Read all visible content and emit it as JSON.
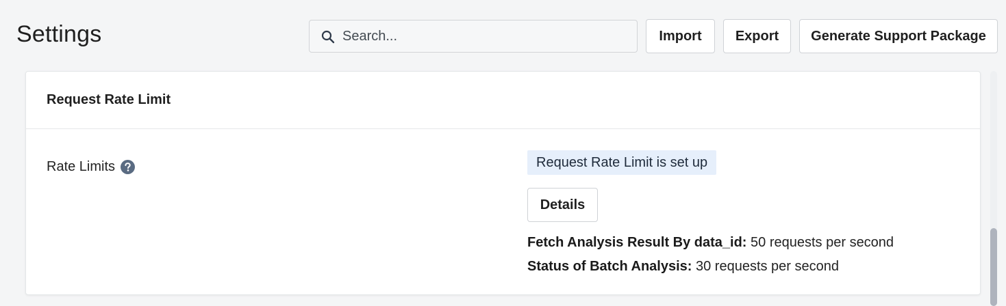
{
  "header": {
    "title": "Settings",
    "search_placeholder": "Search...",
    "import_label": "Import",
    "export_label": "Export",
    "support_label": "Generate Support Package"
  },
  "card": {
    "title": "Request Rate Limit",
    "row_label": "Rate Limits",
    "status_text": "Request Rate Limit is set up",
    "details_label": "Details",
    "limits": [
      {
        "name": "Fetch Analysis Result By data_id:",
        "value": "50 requests per second"
      },
      {
        "name": "Status of Batch Analysis:",
        "value": "30 requests per second"
      }
    ]
  },
  "icons": {
    "search": "search-icon",
    "help": "help-circle-icon"
  },
  "colors": {
    "background": "#f4f5f6",
    "status_badge_bg": "#e6effb",
    "help_icon": "#5a6b82",
    "scrollbar_thumb": "#aeb3bd"
  }
}
